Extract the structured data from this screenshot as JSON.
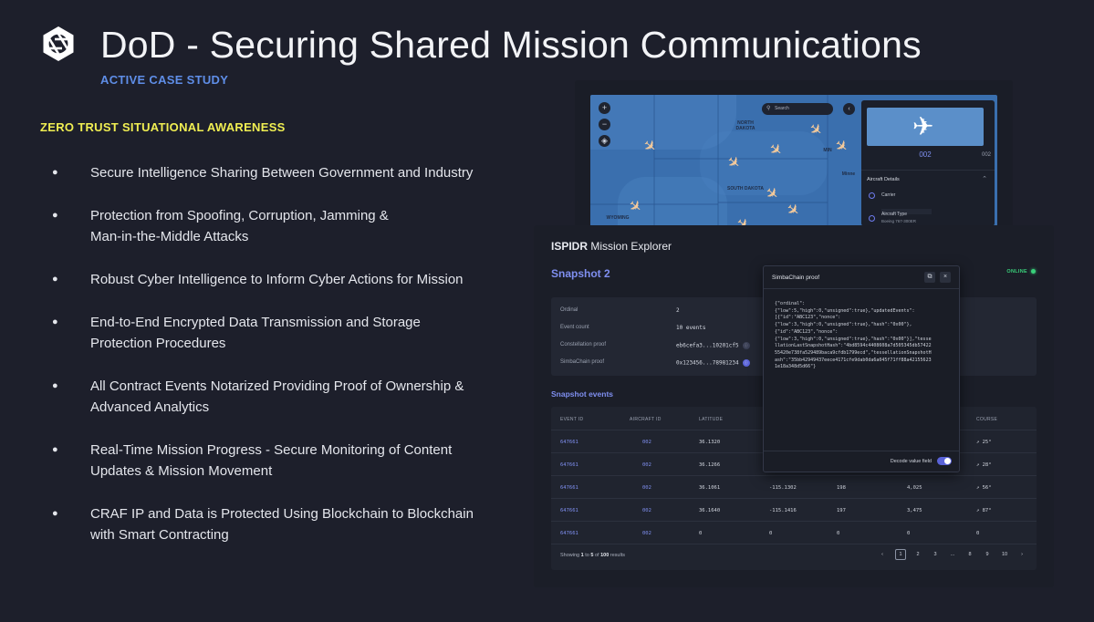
{
  "slide": {
    "title": "DoD - Securing Shared Mission Communications",
    "subtitle": "ACTIVE CASE STUDY",
    "section_label": "ZERO TRUST SITUATIONAL AWARENESS",
    "bullets": [
      [
        "Secure Intelligence Sharing Between Government and Industry"
      ],
      [
        "Protection from Spoofing, Corruption, Jamming &",
        "Man-in-the-Middle Attacks"
      ],
      [
        "Robust Cyber Intelligence to Inform Cyber Actions for Mission"
      ],
      [
        "End-to-End Encrypted Data Transmission and Storage",
        "Protection Procedures"
      ],
      [
        "All Contract Events Notarized Providing Proof of Ownership &",
        "Advanced Analytics"
      ],
      [
        "Real-Time Mission Progress - Secure Monitoring of Content",
        "Updates & Mission Movement"
      ],
      [
        "CRAF IP and Data is Protected Using Blockchain to Blockchain",
        "with Smart Contracting"
      ]
    ]
  },
  "map": {
    "search_placeholder": "Search",
    "labels": [
      "NORTH DAKOTA",
      "SOUTH DAKOTA",
      "WYOMING",
      "MIN",
      "Minne"
    ],
    "panel": {
      "aircraft_id": "002",
      "aircraft_id_small": "002",
      "details_heading": "Aircraft Details",
      "carrier_label": "Carrier",
      "type_label": "Aircraft Type",
      "type_value": "Boeing 767-300ER"
    }
  },
  "explorer": {
    "title_bold": "ISPIDR",
    "title_rest": " Mission Explorer",
    "snapshot_title": "Snapshot 2",
    "status": "ONLINE",
    "snapshot_fields": [
      {
        "key": "Ordinal",
        "value": "2"
      },
      {
        "key": "Event count",
        "value": "10 events"
      },
      {
        "key": "Constellation proof",
        "value": "eb6cefa3...10201cf5"
      },
      {
        "key": "SimbaChain proof",
        "value": "0x123456...78981234"
      }
    ],
    "events_title": "Snapshot events",
    "columns": [
      "EVENT ID",
      "AIRCRAFT ID",
      "LATITUDE",
      "COURSE"
    ],
    "rows": [
      {
        "event_id": "647661",
        "aircraft_id": "002",
        "latitude": "36.1320",
        "longitude": "",
        "speed": "",
        "altitude": "",
        "course": "↗ 25°"
      },
      {
        "event_id": "647661",
        "aircraft_id": "002",
        "latitude": "36.1266",
        "longitude": "",
        "speed": "",
        "altitude": "",
        "course": "↗ 28°"
      },
      {
        "event_id": "647661",
        "aircraft_id": "002",
        "latitude": "36.1061",
        "longitude": "-115.1302",
        "speed": "198",
        "altitude": "4,025",
        "course": "↗ 56°"
      },
      {
        "event_id": "647661",
        "aircraft_id": "002",
        "latitude": "36.1640",
        "longitude": "-115.1416",
        "speed": "197",
        "altitude": "3,475",
        "course": "↗ 87°"
      },
      {
        "event_id": "647661",
        "aircraft_id": "002",
        "latitude": "0",
        "longitude": "0",
        "speed": "0",
        "altitude": "0",
        "course": "0"
      }
    ],
    "pager": {
      "prefix": "Showing ",
      "from": "1",
      "to_word": " to ",
      "to": "5",
      "of_word": " of ",
      "total": "100",
      "suffix": " results",
      "pages": [
        "1",
        "2",
        "3",
        "...",
        "8",
        "9",
        "10"
      ],
      "active_page": "1",
      "prev": "‹",
      "next": "›"
    }
  },
  "modal": {
    "title": "SimbaChain proof",
    "code": "{\"ordinal\":\n{\"low\":5,\"high\":0,\"unsigned\":true},\"updatedEvents\":\n[{\"id\":\"ABC123\",\"nonce\":\n{\"low\":3,\"high\":0,\"unsigned\":true},\"hash\":\"0x00\"},\n{\"id\":\"ABC123\",\"nonce\":\n{\"low\":3,\"high\":0,\"unsigned\":true},\"hash\":\"0x00\"}],\"tesse\nllationLastSnapshotHash\":\"4bd8594c4408608a7d505345db57422\n55420e738fa529489baca9cfdb1799ecd\",\"tessellationSnapshotH\nash\":\"35bb42949437eece4171cfe9dab0da6a045f71ff88a42155623\n1e18a348d5d66\"}",
    "decode_label": "Decode value field",
    "decode_on": true
  },
  "colors": {
    "background": "#1d1f2b",
    "accent_blue": "#5f8ee8",
    "accent_yellow": "#f0ee52",
    "link_purple": "#7f8ff0",
    "online_green": "#39d07a"
  }
}
